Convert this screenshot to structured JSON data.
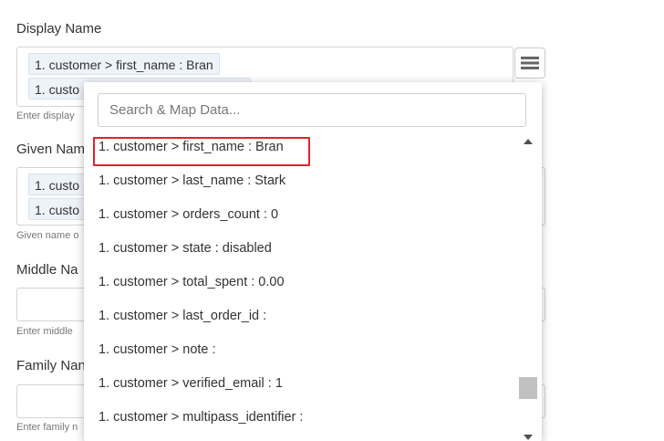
{
  "display_name": {
    "label": "Display Name",
    "chips": [
      "1. customer > first_name : Bran",
      "1. custo"
    ],
    "help": "Enter display"
  },
  "given_name": {
    "label": "Given Nam",
    "chips": [
      "1. custo",
      "1. custo"
    ],
    "help": "Given name o"
  },
  "middle_name": {
    "label": "Middle Na",
    "help": "Enter middle"
  },
  "family_name": {
    "label": "Family Nan",
    "help": "Enter family n"
  },
  "dropdown": {
    "search_placeholder": "Search & Map Data...",
    "options": [
      "1. customer > first_name : Bran",
      "1. customer > last_name : Stark",
      "1. customer > orders_count : 0",
      "1. customer > state : disabled",
      "1. customer > total_spent : 0.00",
      "1. customer > last_order_id :",
      "1. customer > note :",
      "1. customer > verified_email : 1",
      "1. customer > multipass_identifier :"
    ],
    "highlighted_index": 0
  },
  "icons": {
    "menu": "hamburger-menu-icon"
  }
}
